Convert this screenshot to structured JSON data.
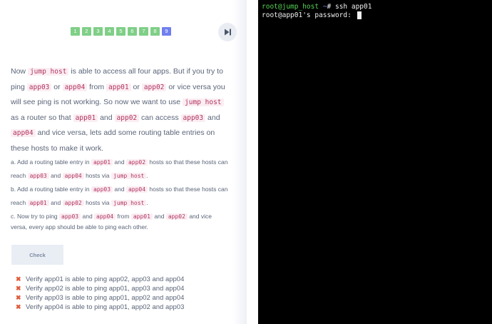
{
  "pager": {
    "pages": [
      "1",
      "2",
      "3",
      "4",
      "5",
      "6",
      "7",
      "8",
      "9"
    ],
    "active_page": "9",
    "skip_icon": "skip-to-end-icon"
  },
  "question": {
    "intro": [
      {
        "t": "Now "
      },
      {
        "c": "jump host"
      },
      {
        "t": " is able to access all four apps. But if you try to ping "
      },
      {
        "c": "app03"
      },
      {
        "t": " or "
      },
      {
        "c": "app04"
      },
      {
        "t": " from "
      },
      {
        "c": "app01"
      },
      {
        "t": " or "
      },
      {
        "c": "app02"
      },
      {
        "t": " or vice versa you will see ping is not working. So now we want to use "
      },
      {
        "c": "jump host"
      },
      {
        "t": " as a router so that "
      },
      {
        "c": "app01"
      },
      {
        "t": " and "
      },
      {
        "c": "app02"
      },
      {
        "t": " can access "
      },
      {
        "c": "app03"
      },
      {
        "t": " and "
      },
      {
        "c": "app04"
      },
      {
        "t": " and vice versa, lets add some routing table entries on these hosts to make it work."
      }
    ],
    "step_a": [
      {
        "t": "a. Add a routing table entry in "
      },
      {
        "c": "app01"
      },
      {
        "t": " and "
      },
      {
        "c": "app02"
      },
      {
        "t": " hosts so that these hosts can reach "
      },
      {
        "c": "app03"
      },
      {
        "t": " and "
      },
      {
        "c": "app04"
      },
      {
        "t": " hosts via "
      },
      {
        "c": "jump host"
      },
      {
        "t": "."
      }
    ],
    "step_b": [
      {
        "t": "b. Add a routing table entry in "
      },
      {
        "c": "app03"
      },
      {
        "t": " and "
      },
      {
        "c": "app04"
      },
      {
        "t": " hosts so that these hosts can reach "
      },
      {
        "c": "app01"
      },
      {
        "t": " and "
      },
      {
        "c": "app02"
      },
      {
        "t": " hosts via "
      },
      {
        "c": "jump host"
      },
      {
        "t": "."
      }
    ],
    "step_c": [
      {
        "t": "c. Now try to ping "
      },
      {
        "c": "app03"
      },
      {
        "t": " and "
      },
      {
        "c": "app04"
      },
      {
        "t": " from "
      },
      {
        "c": "app01"
      },
      {
        "t": " and "
      },
      {
        "c": "app02"
      },
      {
        "t": " and vice versa, every app should be able to ping each other."
      }
    ]
  },
  "check_button": {
    "label": "Check"
  },
  "results": [
    {
      "icon": "x-mark-icon",
      "text": "Verify app01 is able to ping app02, app03 and app04"
    },
    {
      "icon": "x-mark-icon",
      "text": "Verify app02 is able to ping app01, app03 and app04"
    },
    {
      "icon": "x-mark-icon",
      "text": "Verify app03 is able to ping app01, app02 and app04"
    },
    {
      "icon": "x-mark-icon",
      "text": "Verify app04 is able to ping app01, app02 and app03"
    }
  ],
  "terminal": {
    "prompt_user": "root@jump_host",
    "prompt_path": " ~",
    "prompt_symbol": "# ",
    "command": "ssh app01",
    "line2": "root@app01's password: "
  },
  "colors": {
    "page_done": "#7fcf87",
    "page_active": "#6f7ff0",
    "code_text": "#b1335f",
    "code_bg": "#fbeef3",
    "fail_icon": "#e05a3a",
    "terminal_bg": "#000000",
    "prompt_user": "#55d455",
    "prompt_path": "#6f8cff"
  }
}
